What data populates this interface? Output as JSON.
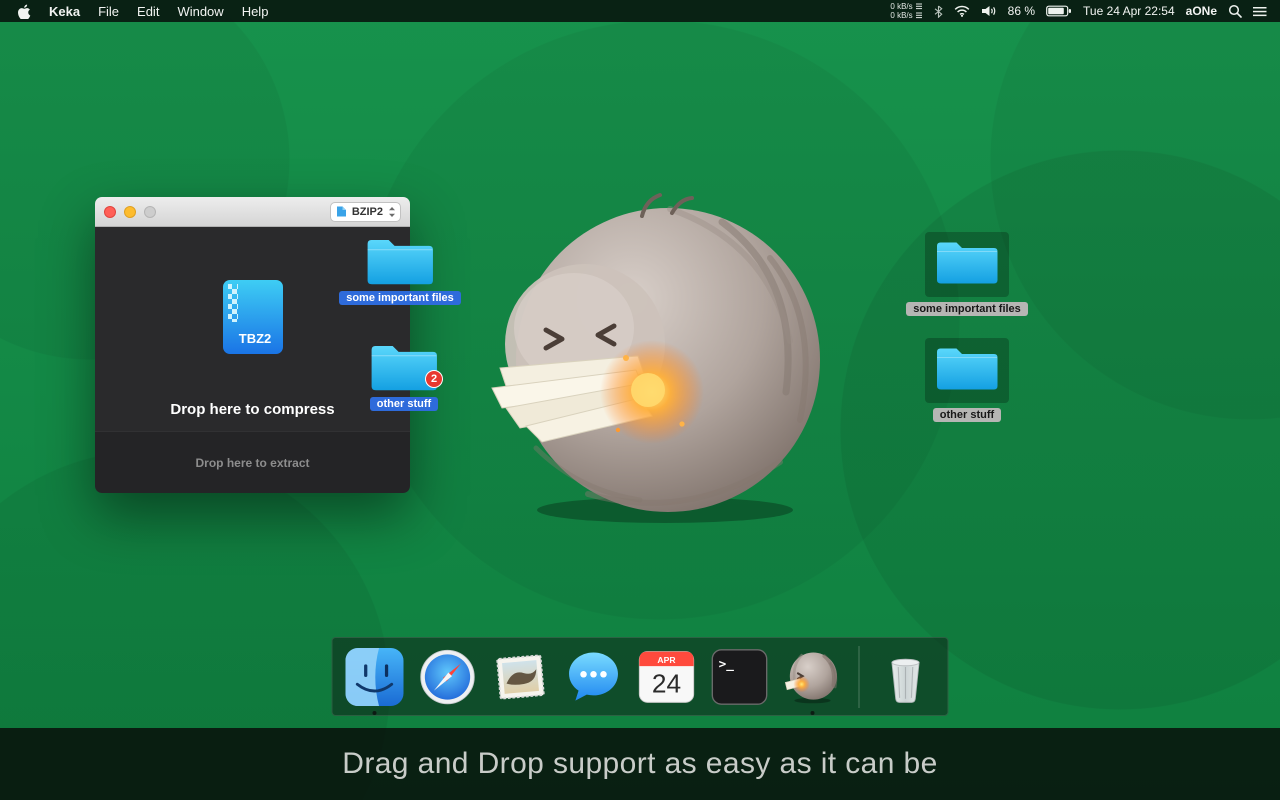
{
  "colors": {
    "desktop_green": "#12864a",
    "folder_cyan": "#2ab5ea",
    "selection_blue": "#2e6bdb",
    "badge_red": "#e8382f",
    "glow_orange": "#ff9a2e",
    "menubar_bg": "#091b11"
  },
  "menu_bar": {
    "app_name": "Keka",
    "menus": [
      "File",
      "Edit",
      "Window",
      "Help"
    ],
    "net_up": "0 kB/s",
    "net_down": "0 kB/s",
    "battery_pct": "86 %",
    "clock": "Tue 24 Apr 22:54",
    "user": "aONe"
  },
  "window": {
    "format": "BZIP2",
    "file_badge": "TBZ2",
    "compress": "Drop here to compress",
    "extract": "Drop here to extract"
  },
  "drag": {
    "folder1": "some important files",
    "folder2": "other stuff",
    "badge": "2"
  },
  "desktop": {
    "folder1": "some important files",
    "folder2": "other stuff"
  },
  "dock": {
    "items": [
      "finder",
      "safari",
      "mail",
      "messages",
      "calendar",
      "terminal",
      "keka",
      "trash"
    ],
    "calendar_month": "APR",
    "calendar_day": "24",
    "terminal_glyph": "&gt;_"
  },
  "caption": "Drag and Drop support as easy as it can be"
}
